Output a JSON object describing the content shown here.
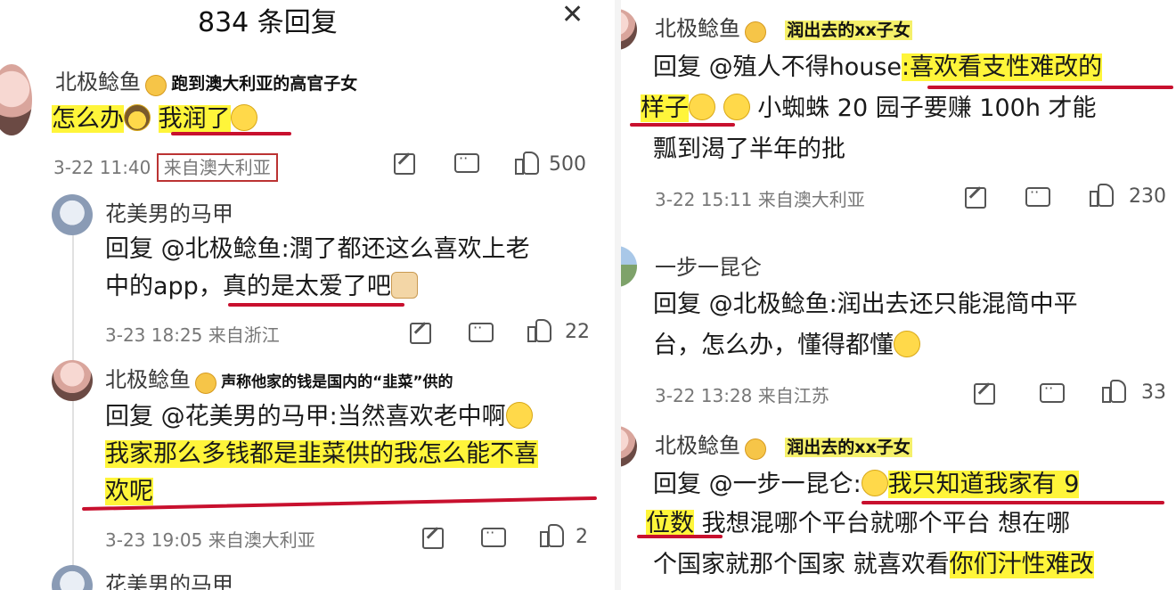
{
  "left": {
    "header": {
      "title": "834 条回复",
      "close": "✕"
    },
    "c1": {
      "user": "北极鲶鱼",
      "tag": "跑到澳大利亚的高官子女",
      "text_plain": "怎么办",
      "text_hl": "我润了",
      "time": "3-22 11:40",
      "location": "来自澳大利亚",
      "likes": "500"
    },
    "r1": {
      "user": "花美男的马甲",
      "line1": "回复 @北极鲶鱼:潤了都还这么喜欢上老",
      "line2_plain": "中的app，",
      "line2_ul": "真的是太爱了吧",
      "time": "3-23 18:25",
      "location": "来自浙江",
      "likes": "22"
    },
    "r2": {
      "user": "北极鲶鱼",
      "tag": "声称他家的钱是国内的“韭菜”供的",
      "line1": "回复 @花美男的马甲:当然喜欢老中啊",
      "line2": "我家那么多钱都是韭菜供的我怎么能不喜",
      "line3": "欢呢",
      "time": "3-23 19:05",
      "location": "来自澳大利亚",
      "likes": "2"
    },
    "r3": {
      "user": "花美男的马甲"
    }
  },
  "right": {
    "c1": {
      "user": "北极鲶鱼",
      "tag": "润出去的xx子女",
      "line1_plain": "回复 @殖人不得house",
      "line1_hl": ":喜欢看支性难改的",
      "line2_hl": "样子",
      "line2_plain": "小蜘蛛 20 园子要赚 100h 才能",
      "line3": "瓢到渴了半年的批",
      "time": "3-22 15:11",
      "location": "来自澳大利亚",
      "likes": "230"
    },
    "c2": {
      "user": "一步一昆仑",
      "line1": "回复 @北极鲶鱼:润出去还只能混简中平",
      "line2": "台，怎么办，懂得都懂",
      "time": "3-22 13:28",
      "location": "来自江苏",
      "likes": "33"
    },
    "c3": {
      "user": "北极鲶鱼",
      "tag": "润出去的xx子女",
      "line1_plain": "回复 @一步一昆仑:",
      "line1_hl": "我只知道我家有 9",
      "line2_hl": "位数",
      "line2_plain": "我想混哪个平台就哪个平台 想在哪",
      "line3_plain": "个国家就那个国家 就喜欢看",
      "line3_hl": "你们汁性难改"
    }
  }
}
